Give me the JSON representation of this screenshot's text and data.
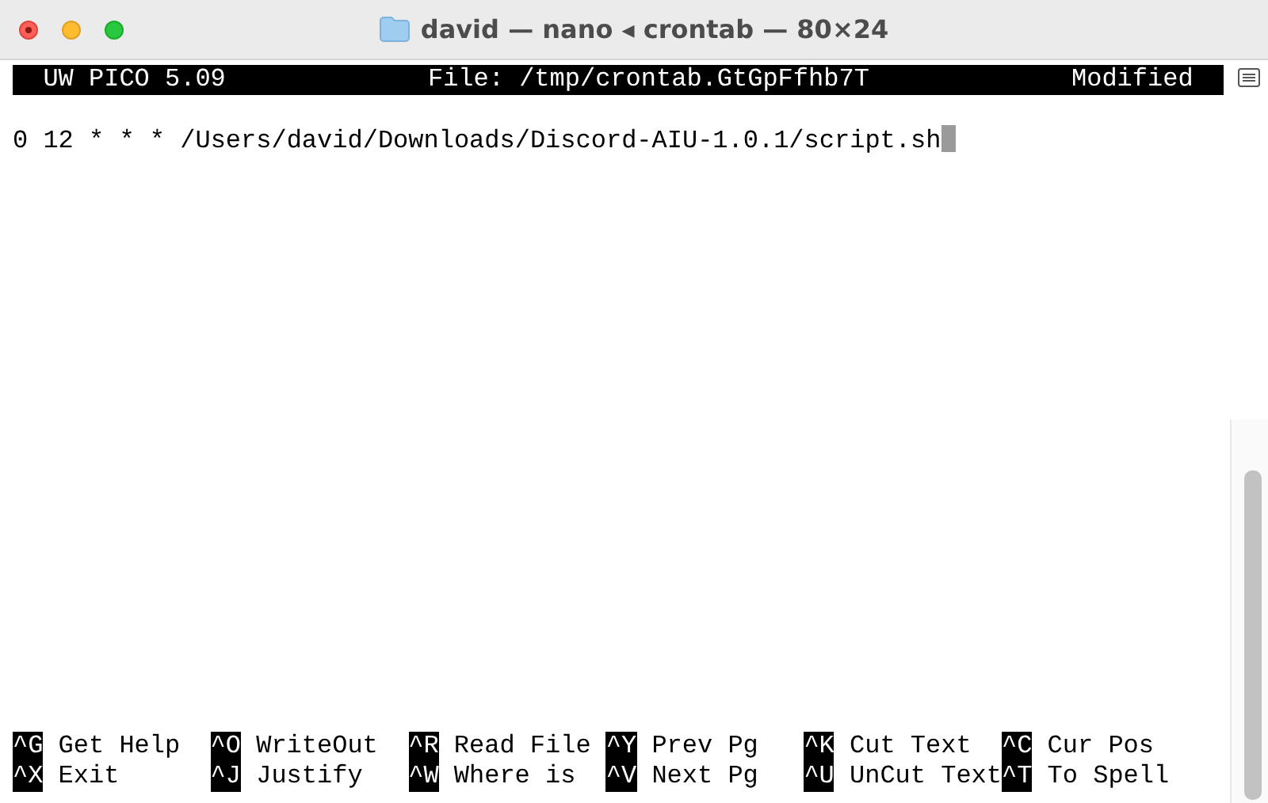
{
  "window": {
    "title": "david — nano ◂ crontab — 80×24"
  },
  "header": {
    "app": "UW PICO 5.09",
    "file": "File: /tmp/crontab.GtGpFfhb7T",
    "status": "Modified"
  },
  "lines": [
    {
      "text": "0 12 * * * /Users/david/Downloads/Discord-AIU-1.0.1/script.sh",
      "cursor": true
    }
  ],
  "shortcuts": [
    {
      "key": "^G",
      "label": "Get Help"
    },
    {
      "key": "^O",
      "label": "WriteOut"
    },
    {
      "key": "^R",
      "label": "Read File"
    },
    {
      "key": "^Y",
      "label": "Prev Pg"
    },
    {
      "key": "^K",
      "label": "Cut Text"
    },
    {
      "key": "^C",
      "label": "Cur Pos"
    },
    {
      "key": "^X",
      "label": "Exit"
    },
    {
      "key": "^J",
      "label": "Justify"
    },
    {
      "key": "^W",
      "label": "Where is"
    },
    {
      "key": "^V",
      "label": "Next Pg"
    },
    {
      "key": "^U",
      "label": "UnCut Text"
    },
    {
      "key": "^T",
      "label": "To Spell"
    }
  ]
}
